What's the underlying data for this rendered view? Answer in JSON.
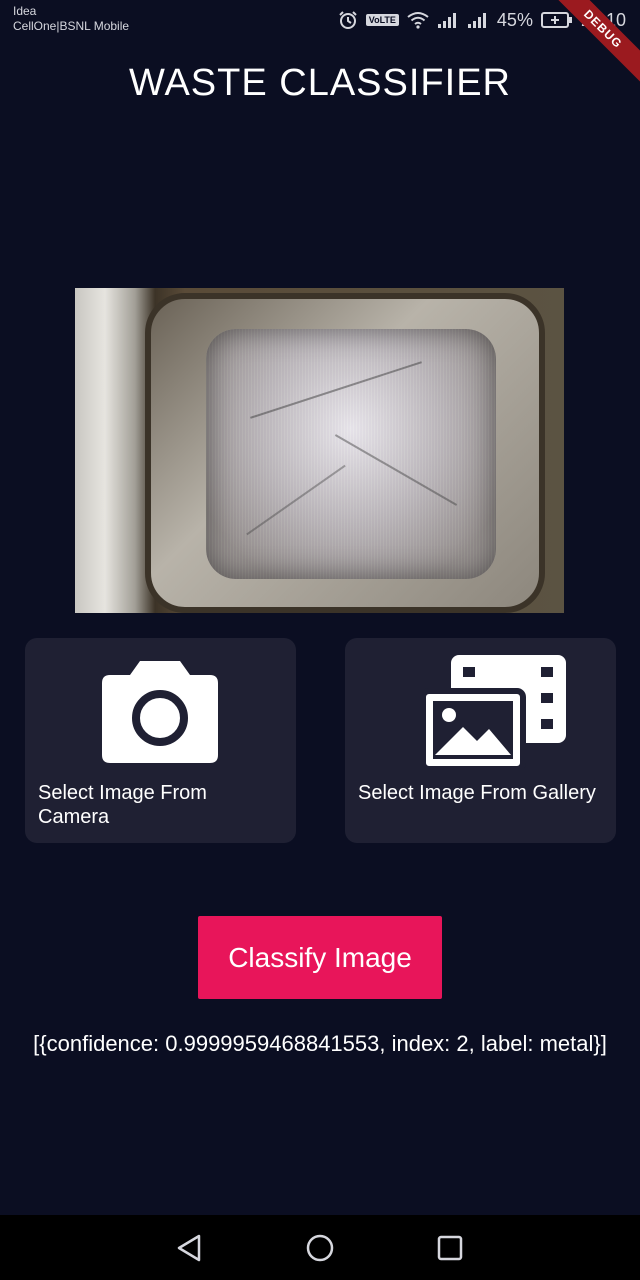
{
  "status_bar": {
    "carrier_1": "Idea",
    "carrier_2": "CellOne|BSNL Mobile",
    "volte": "VoLTE",
    "battery_percent": "45%",
    "time": "23:10",
    "debug_banner": "DEBUG"
  },
  "app": {
    "title": "WASTE  CLASSIFIER"
  },
  "actions": {
    "camera_label": "Select Image From Camera",
    "gallery_label": "Select Image From Gallery",
    "classify_label": "Classify Image"
  },
  "result": {
    "text": "[{confidence: 0.9999959468841553, index: 2, label: metal}]",
    "confidence": 0.9999959468841553,
    "index": 2,
    "label": "metal"
  },
  "icons": {
    "camera": "camera-icon",
    "gallery": "photo-library-icon",
    "nav_back": "back-triangle-icon",
    "nav_home": "home-circle-icon",
    "nav_recents": "recents-square-icon"
  },
  "colors": {
    "background": "#0b0e22",
    "card": "#1f2033",
    "accent": "#e8155a"
  }
}
